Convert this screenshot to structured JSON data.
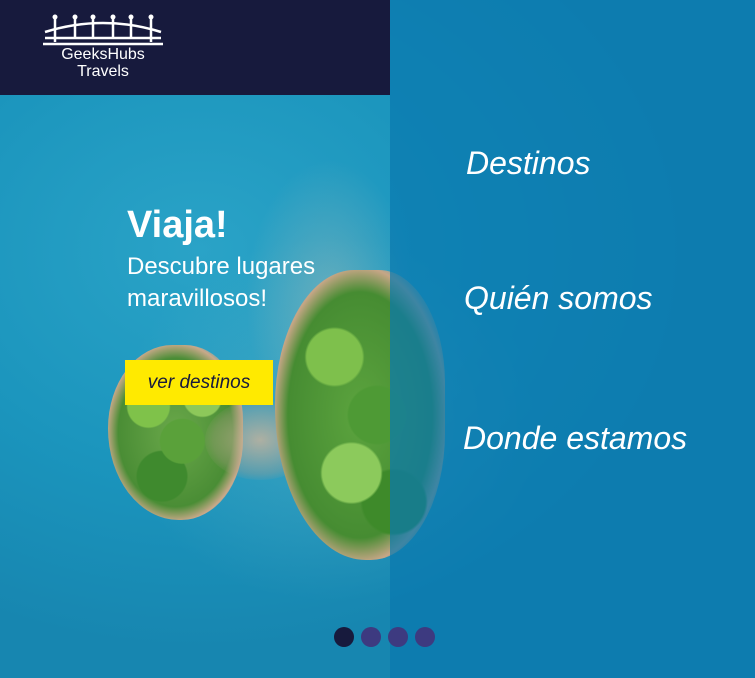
{
  "brand": {
    "name_line1": "GeeksHubs",
    "name_line2": "Travels",
    "logo_icon": "bridge-icon"
  },
  "hero": {
    "title": "Viaja!",
    "subtitle_line1": "Descubre lugares",
    "subtitle_line2": "maravillosos!",
    "cta_label": "ver destinos"
  },
  "nav": {
    "items": [
      {
        "label": "Destinos"
      },
      {
        "label": "Quién somos"
      },
      {
        "label": "Donde estamos"
      }
    ]
  },
  "carousel": {
    "slide_count": 4,
    "active_index": 0
  },
  "colors": {
    "header_bg": "#171a3d",
    "cta_bg": "#ffea00",
    "dot_active": "#171a3d",
    "dot_inactive": "#3d3a80",
    "menu_overlay": "#0a78af"
  }
}
